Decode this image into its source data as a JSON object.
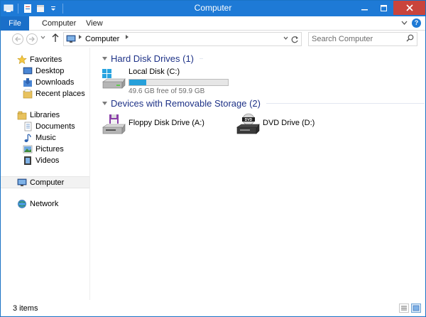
{
  "window": {
    "title": "Computer"
  },
  "ribbon": {
    "tabs": [
      {
        "label": "File"
      },
      {
        "label": "Computer"
      },
      {
        "label": "View"
      }
    ],
    "help_label": "?"
  },
  "address_bar": {
    "crumbs": [
      "Computer"
    ],
    "search_placeholder": "Search Computer"
  },
  "nav": {
    "favorites": {
      "label": "Favorites",
      "items": [
        "Desktop",
        "Downloads",
        "Recent places"
      ]
    },
    "libraries": {
      "label": "Libraries",
      "items": [
        "Documents",
        "Music",
        "Pictures",
        "Videos"
      ]
    },
    "computer": "Computer",
    "network": "Network"
  },
  "content": {
    "groups": [
      {
        "title": "Hard Disk Drives (1)",
        "drives": [
          {
            "name": "Local Disk (C:)",
            "size_text": "49.6 GB free of 59.9 GB",
            "used_fraction": 0.17,
            "icon": "hard-disk-icon"
          }
        ]
      },
      {
        "title": "Devices with Removable Storage (2)",
        "drives": [
          {
            "name": "Floppy Disk Drive (A:)",
            "icon": "floppy-drive-icon"
          },
          {
            "name": "DVD Drive (D:)",
            "icon": "dvd-drive-icon"
          }
        ]
      }
    ]
  },
  "status": {
    "count_text": "3 items"
  },
  "colors": {
    "titlebar": "#1e7ad6",
    "close_button": "#c9443c",
    "group_header": "#1e3287",
    "usage_bar": "#26a0da"
  }
}
